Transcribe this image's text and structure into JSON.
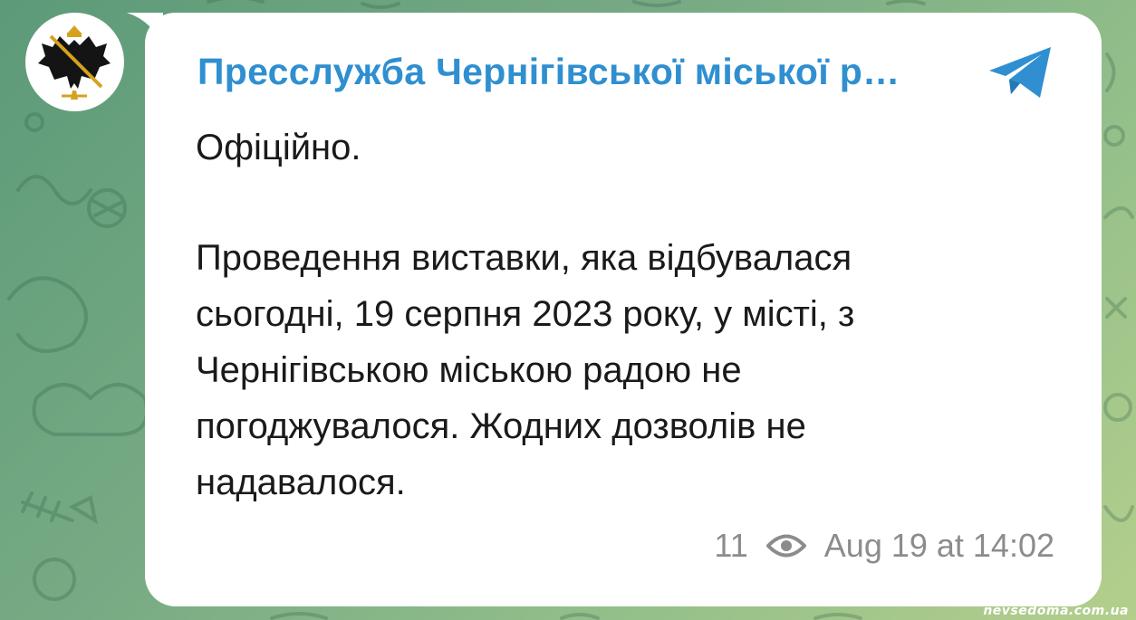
{
  "background": {
    "colors": [
      "#5c9a79",
      "#93bf8a",
      "#b4cf8c"
    ]
  },
  "message": {
    "channel_name": "Пресслужба Чернігівської міської р…",
    "avatar_icon": "chernihiv-coat-of-arms-icon",
    "share_icon": "telegram-share-icon",
    "text_first": "Офіційно.",
    "body_lines": [
      "Проведення виставки, яка відбувалася",
      "сьогодні, 19 серпня 2023 року, у місті, з",
      "Чернігівською міською радою не",
      "погоджувалося. Жодних дозволів не",
      "надавалося."
    ],
    "views": "11",
    "views_icon": "eye-icon",
    "timestamp": "Aug 19 at 14:02",
    "accent_color": "#2f8fd0"
  },
  "watermark": "nevsedoma.com.ua"
}
